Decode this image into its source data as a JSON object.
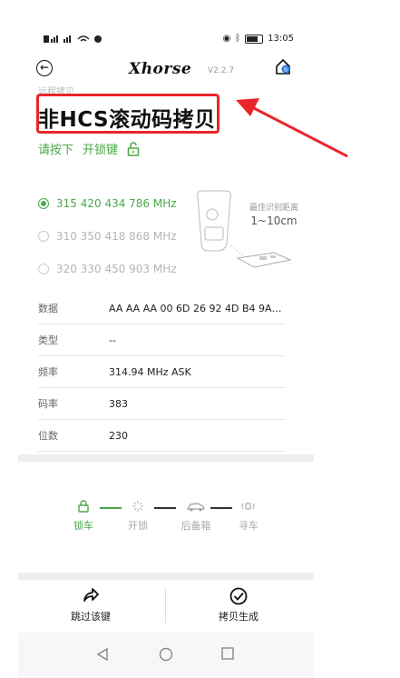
{
  "status": {
    "time": "13:05",
    "carrier_icons": "signal-wifi-icons"
  },
  "header": {
    "brand": "Xhorse",
    "version": "V2.2.7"
  },
  "breadcrumb": "远程拷贝",
  "page_title": "非HCS滚动码拷贝",
  "hint": {
    "press": "请按下",
    "key": "开锁键"
  },
  "frequencies": [
    {
      "label": "315 420 434 786 MHz",
      "selected": true
    },
    {
      "label": "310 350 418 868 MHz",
      "selected": false
    },
    {
      "label": "320 330 450 903 MHz",
      "selected": false
    }
  ],
  "illustration": {
    "caption": "最佳识别距离",
    "distance": "1~10cm"
  },
  "details": [
    {
      "key": "数据",
      "value": "AA AA AA 00 6D 26 92 4D B4 9A 4..."
    },
    {
      "key": "类型",
      "value": "--"
    },
    {
      "key": "频率",
      "value": "314.94 MHz ASK"
    },
    {
      "key": "码率",
      "value": "383"
    },
    {
      "key": "位数",
      "value": "230"
    }
  ],
  "steps": [
    {
      "label": "锁车",
      "active": true
    },
    {
      "label": "开锁",
      "active": false
    },
    {
      "label": "后备箱",
      "active": false
    },
    {
      "label": "寻车",
      "active": false
    }
  ],
  "actions": {
    "skip": "跳过该键",
    "generate": "拷贝生成"
  },
  "colors": {
    "accent": "#4aa94a",
    "annotation": "#e8262a"
  }
}
